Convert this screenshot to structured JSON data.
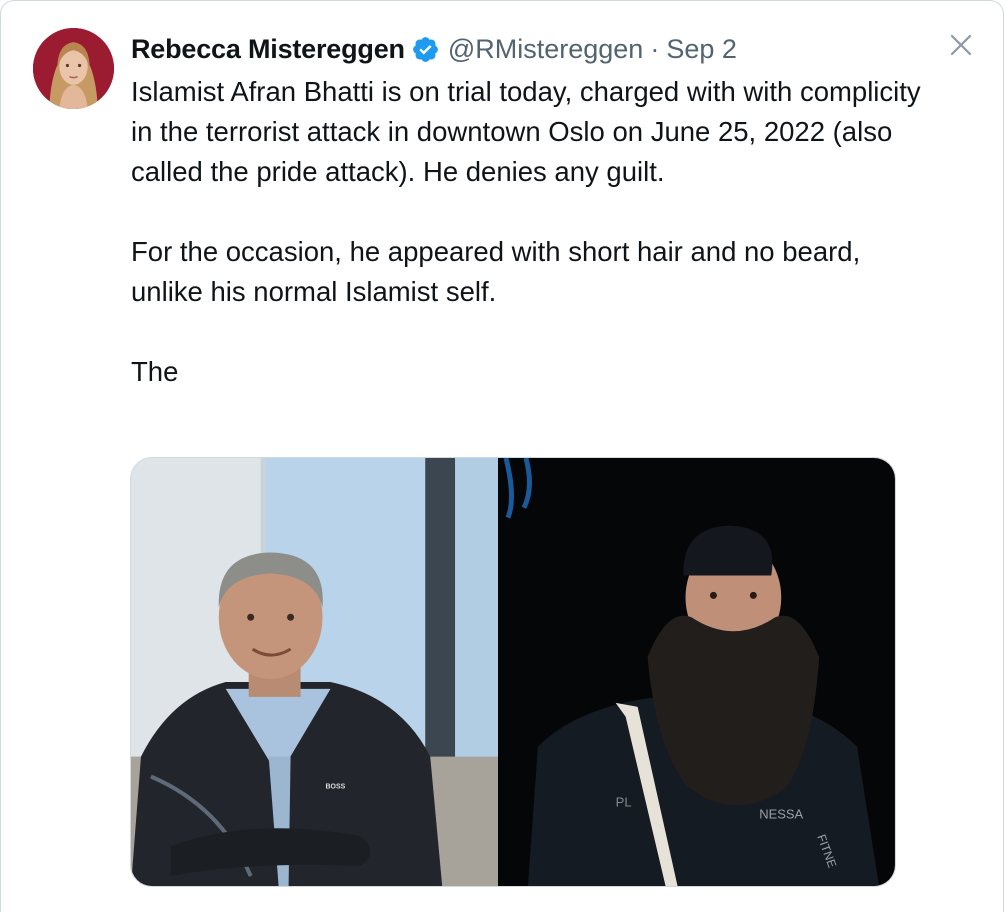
{
  "tweet": {
    "author_name": "Rebecca Mistereggen",
    "handle": "@RMistereggen",
    "separator": "·",
    "date": "Sep 2",
    "paragraphs": [
      "Islamist Afran Bhatti is on trial today, charged with with complicity in the terrorist attack in downtown Oslo on June 25, 2022 (also called the pride attack). He denies any guilt.",
      "For the occasion, he appeared with short hair and no beard, unlike his normal Islamist self.",
      "The"
    ],
    "jacket_logo_text": "BOSS",
    "right_jacket_text": "NESSA",
    "right_sleeve_text": "FITNE"
  },
  "icons": {
    "verified": "verified-badge-icon",
    "close": "close-icon"
  },
  "colors": {
    "verified_blue": "#1d9bf0",
    "secondary_text": "#536471",
    "border": "#cfd9de",
    "avatar_bg": "#9b1b30"
  }
}
